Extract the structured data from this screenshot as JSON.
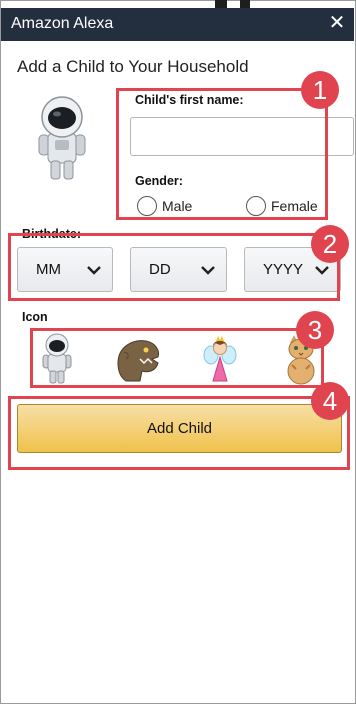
{
  "window": {
    "title": "Amazon Alexa",
    "close_icon": "close-icon"
  },
  "heading": "Add a Child to Your Household",
  "form": {
    "first_name_label": "Child's first name:",
    "first_name_value": "",
    "gender_label": "Gender:",
    "gender_options": [
      "Male",
      "Female"
    ],
    "birthdate_label": "Birthdate:",
    "birthdate": {
      "month": "MM",
      "day": "DD",
      "year": "YYYY"
    },
    "icon_label": "Icon",
    "icons": [
      "astronaut-icon",
      "dinosaur-icon",
      "fairy-icon",
      "kitten-icon"
    ],
    "submit_label": "Add Child"
  },
  "callouts": [
    "1",
    "2",
    "3",
    "4"
  ],
  "colors": {
    "titlebar": "#232f3e",
    "callout": "#e0454f",
    "button_top": "#f7dfa5",
    "button_bottom": "#f0c14b"
  }
}
